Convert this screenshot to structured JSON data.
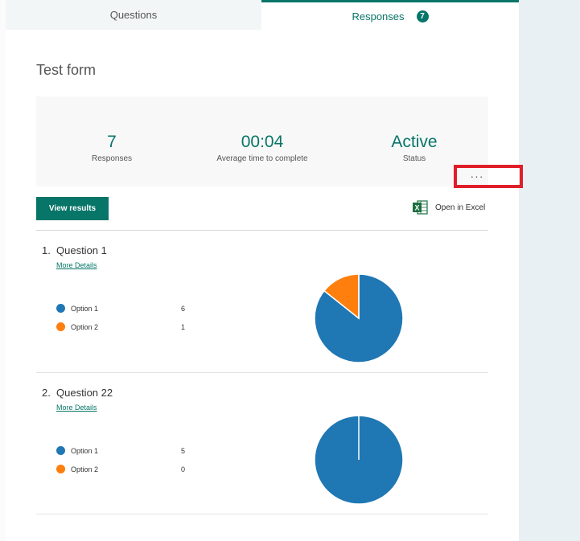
{
  "tabs": {
    "questions": "Questions",
    "responses": "Responses",
    "responses_badge": "7"
  },
  "form": {
    "title": "Test form"
  },
  "summary": {
    "responses_value": "7",
    "responses_label": "Responses",
    "avg_time_value": "00:04",
    "avg_time_label": "Average time to complete",
    "status_value": "Active",
    "status_label": "Status",
    "more_label": "···"
  },
  "actions": {
    "view_results": "View results",
    "open_excel": "Open in Excel",
    "excel_icon_glyph": "X"
  },
  "colors": {
    "accent": "#077568",
    "option1": "#1f77b4",
    "option2": "#ff7f0e",
    "highlight": "#e01e2a"
  },
  "questions": [
    {
      "number": "1.",
      "title": "Question 1",
      "more_details": "More Details",
      "options": [
        {
          "label": "Option 1",
          "count": "6",
          "value": 6
        },
        {
          "label": "Option 2",
          "count": "1",
          "value": 1
        }
      ]
    },
    {
      "number": "2.",
      "title": "Question 22",
      "more_details": "More Details",
      "options": [
        {
          "label": "Option 1",
          "count": "5",
          "value": 5
        },
        {
          "label": "Option 2",
          "count": "0",
          "value": 0
        }
      ]
    }
  ]
}
